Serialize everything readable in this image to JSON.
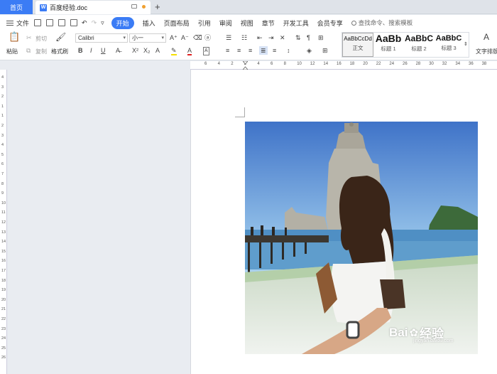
{
  "tabs": {
    "home": "首页",
    "document": "百度经验.doc"
  },
  "menu": {
    "file": "文件",
    "items": [
      "开始",
      "插入",
      "页面布局",
      "引用",
      "审阅",
      "视图",
      "章节",
      "开发工具",
      "会员专享"
    ],
    "active": "开始",
    "search": "查找命令、搜索模板"
  },
  "ribbon": {
    "paste": "粘贴",
    "cut": "剪切",
    "copy": "复制",
    "format_painter": "格式刷",
    "font": "Calibri",
    "font_size": "小一",
    "text_layout": "文字排版",
    "styles": [
      {
        "sample": "AaBbCcDd",
        "name": "正文"
      },
      {
        "sample": "AaBb",
        "name": "标题 1"
      },
      {
        "sample": "AaBbC",
        "name": "标题 2"
      },
      {
        "sample": "AaBbC",
        "name": "标题 3"
      }
    ]
  },
  "ruler": {
    "h_labels": [
      "6",
      "4",
      "2",
      "2",
      "4",
      "6",
      "8",
      "10",
      "12",
      "14",
      "16",
      "18",
      "20",
      "22",
      "24",
      "26",
      "28",
      "30",
      "32",
      "34",
      "36",
      "38"
    ],
    "v_labels": [
      "4",
      "3",
      "2",
      "1",
      "1",
      "2",
      "3",
      "4",
      "5",
      "6",
      "7",
      "8",
      "9",
      "10",
      "11",
      "12",
      "13",
      "14",
      "15",
      "16",
      "17",
      "18",
      "19",
      "20",
      "21",
      "22",
      "23",
      "24",
      "25",
      "26"
    ]
  },
  "watermark": {
    "brand": "Bai",
    "suffix": "经验",
    "url": "jingyan.baidu.com"
  },
  "colors": {
    "accent": "#3b7cf5",
    "sky": "#7fb8e8",
    "water": "#4f8fc4"
  }
}
